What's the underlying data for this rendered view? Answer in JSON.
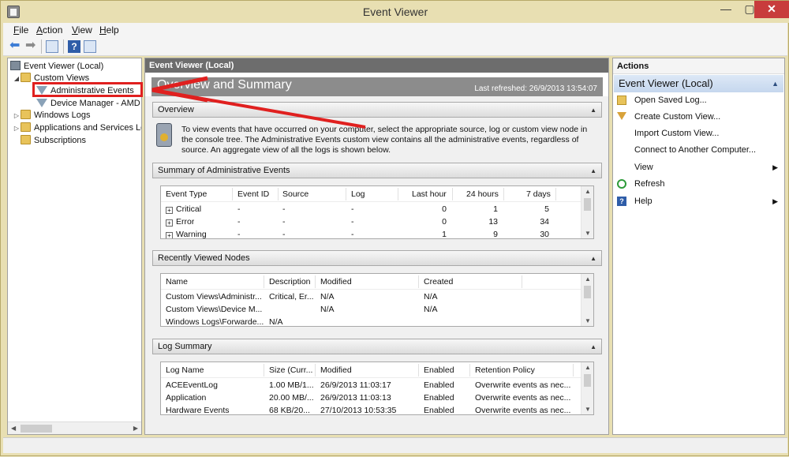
{
  "window": {
    "title": "Event Viewer",
    "controls": {
      "minimize": "—",
      "maximize": "▢",
      "close": "✕"
    }
  },
  "menu": [
    {
      "key": "F",
      "rest": "ile"
    },
    {
      "key": "A",
      "rest": "ction"
    },
    {
      "key": "V",
      "rest": "iew"
    },
    {
      "key": "H",
      "rest": "elp"
    }
  ],
  "toolbar": {
    "back_icon": "back-arrow-icon",
    "forward_icon": "forward-arrow-icon",
    "help_label": "?"
  },
  "tree": {
    "root": "Event Viewer (Local)",
    "custom_views": "Custom Views",
    "admin_events": "Administrative Events",
    "device_manager": "Device Manager - AMD R",
    "windows_logs": "Windows Logs",
    "apps_services": "Applications and Services Lo",
    "subscriptions": "Subscriptions"
  },
  "center": {
    "header": "Event Viewer (Local)",
    "overview_title": "Overview and Summary",
    "last_refreshed": "Last refreshed: 26/9/2013 13:54:07",
    "overview_section": "Overview",
    "overview_text": "To view events that have occurred on your computer, select the appropriate source, log or custom view node in the console tree. The Administrative Events custom view contains all the administrative events, regardless of source. An aggregate view of all the logs is shown below.",
    "summary_section": "Summary of Administrative Events",
    "summary_columns": [
      "Event Type",
      "Event ID",
      "Source",
      "Log",
      "Last hour",
      "24 hours",
      "7 days"
    ],
    "summary_rows": [
      [
        "Critical",
        "-",
        "-",
        "-",
        "0",
        "1",
        "5"
      ],
      [
        "Error",
        "-",
        "-",
        "-",
        "0",
        "13",
        "34"
      ],
      [
        "Warning",
        "-",
        "-",
        "-",
        "1",
        "9",
        "30"
      ]
    ],
    "recent_section": "Recently Viewed Nodes",
    "recent_columns": [
      "Name",
      "Description",
      "Modified",
      "Created"
    ],
    "recent_rows": [
      [
        "Custom Views\\Administr...",
        "Critical, Er...",
        "N/A",
        "N/A"
      ],
      [
        "Custom Views\\Device M...",
        "",
        "N/A",
        "N/A"
      ],
      [
        "Windows Logs\\Forwarde...",
        "N/A",
        "",
        ""
      ]
    ],
    "log_section": "Log Summary",
    "log_columns": [
      "Log Name",
      "Size (Curr...",
      "Modified",
      "Enabled",
      "Retention Policy"
    ],
    "log_rows": [
      [
        "ACEEventLog",
        "1.00 MB/1...",
        "26/9/2013 11:03:17",
        "Enabled",
        "Overwrite events as nec..."
      ],
      [
        "Application",
        "20.00 MB/...",
        "26/9/2013 11:03:13",
        "Enabled",
        "Overwrite events as nec..."
      ],
      [
        "Hardware Events",
        "68 KB/20...",
        "27/10/2013 10:53:35",
        "Enabled",
        "Overwrite events as nec..."
      ]
    ]
  },
  "actions": {
    "header": "Actions",
    "subheader": "Event Viewer (Local)",
    "items": [
      {
        "label": "Open Saved Log...",
        "icon": "folder-open-icon"
      },
      {
        "label": "Create Custom View...",
        "icon": "funnel-icon"
      },
      {
        "label": "Import Custom View...",
        "icon": ""
      },
      {
        "label": "Connect to Another Computer...",
        "icon": ""
      },
      {
        "label": "View",
        "icon": "",
        "submenu": "▶"
      },
      {
        "label": "Refresh",
        "icon": "refresh-icon"
      },
      {
        "label": "Help",
        "icon": "help-icon",
        "submenu": "▶"
      }
    ]
  },
  "colors": {
    "annotation_red": "#e0201f",
    "header_gray": "#6d6d6d",
    "titlebar": "#e8dfb2",
    "close_red": "#c83c3c"
  }
}
